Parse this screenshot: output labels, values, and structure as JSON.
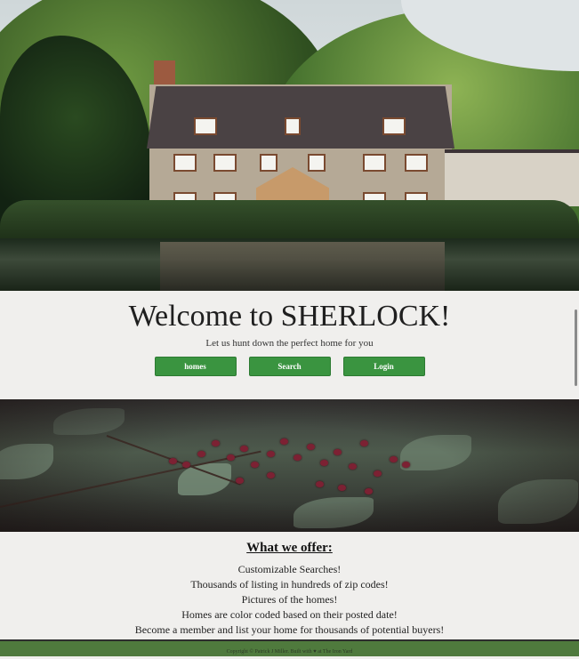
{
  "hero": {
    "image_alt": "house-by-lake"
  },
  "welcome": {
    "title": "Welcome to SHERLOCK!",
    "subtitle": "Let us hunt down the perfect home for you",
    "buttons": [
      {
        "label": "homes"
      },
      {
        "label": "Search"
      },
      {
        "label": "Login"
      }
    ]
  },
  "offer": {
    "heading": "What we offer:",
    "items": [
      "Customizable Searches!",
      "Thousands of listing in hundreds of zip codes!",
      "Pictures of the homes!",
      "Homes are color coded based on their posted date!",
      "Become a member and list your home for thousands of potential buyers!"
    ]
  },
  "footer": {
    "text": "Copyright © Patrick J Miller. Built with ♥ at The Iron Yard"
  },
  "colors": {
    "button_green": "#3a9440",
    "footer_green": "#4f7a3d",
    "background": "#f0efed"
  }
}
